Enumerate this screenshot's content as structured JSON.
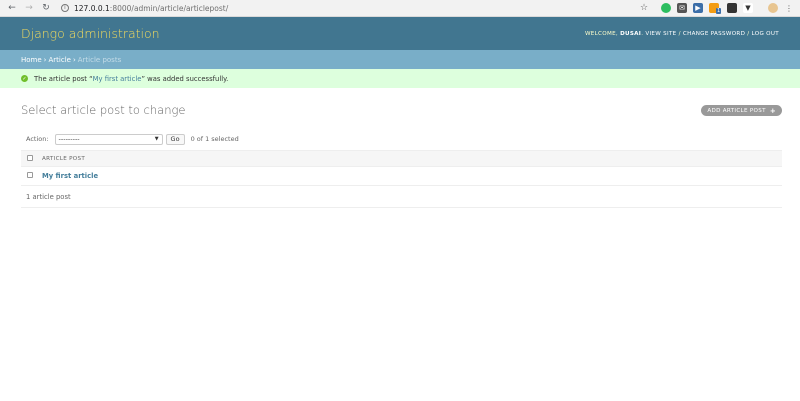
{
  "browser": {
    "url_host": "127.0.0.1",
    "url_path": ":8000/admin/article/articlepost/",
    "nav_icons": [
      "back-icon",
      "forward-icon",
      "reload-icon"
    ],
    "extension_icons": [
      "star-icon",
      "evernote-icon",
      "mail-icon",
      "video-icon",
      "rss-icon",
      "notes-icon",
      "pin-icon",
      "avatar-icon",
      "menu-icon"
    ],
    "rss_badge": "1"
  },
  "header": {
    "branding": "Django administration",
    "welcome": "Welcome,",
    "username": "dusai",
    "dot": ".",
    "view_site": "View site",
    "change_password": "Change password",
    "log_out": "Log out",
    "sep": "/"
  },
  "breadcrumbs": {
    "home": "Home",
    "app": "Article",
    "current": "Article posts",
    "sep": "›"
  },
  "message": {
    "prefix": "The article post “",
    "link": "My first article",
    "suffix": "” was added successfully.",
    "color": "#dfd"
  },
  "content": {
    "title": "Select article post to change",
    "add_button": "Add article post",
    "add_plus": "+",
    "actions": {
      "label": "Action:",
      "selected": "---------",
      "go": "Go",
      "counter": "0 of 1 selected"
    },
    "table": {
      "column": "Article post",
      "rows": [
        {
          "title": "My first article"
        }
      ]
    },
    "paginator": "1 article post"
  },
  "colors": {
    "header_bg": "#417690",
    "breadcrumbs_bg": "#79aec8",
    "branding": "#f5dd5d",
    "link": "#447e9b"
  }
}
